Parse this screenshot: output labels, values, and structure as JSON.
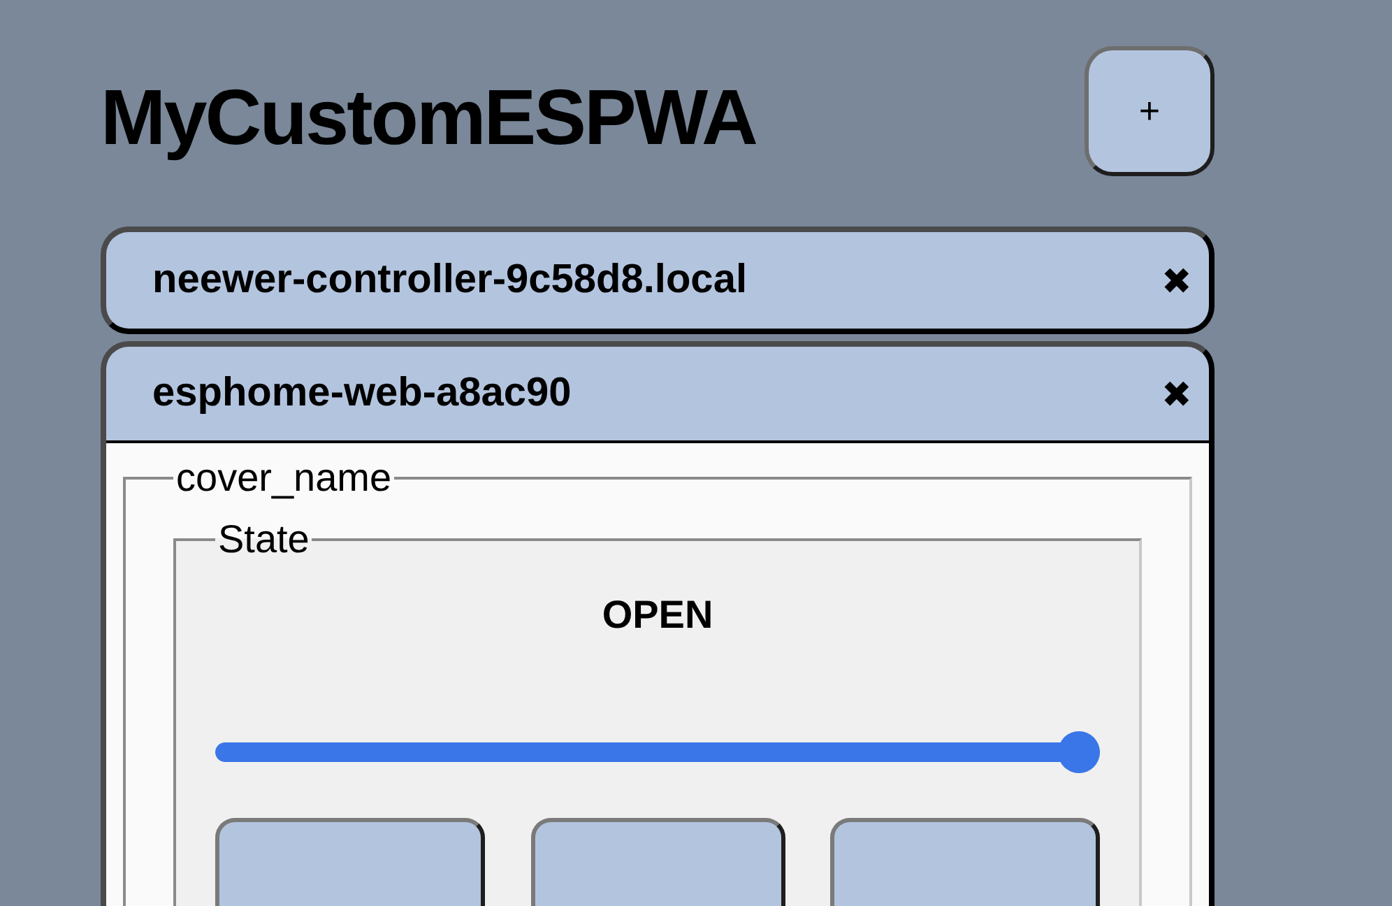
{
  "app_title": "MyCustomESPWA",
  "add_button": {
    "label": "+"
  },
  "devices": [
    {
      "name": "neewer-controller-9c58d8.local",
      "close_label": "✖",
      "expanded": false
    },
    {
      "name": "esphome-web-a8ac90",
      "close_label": "✖",
      "expanded": true,
      "entity": {
        "name": "cover_name",
        "state_legend": "State",
        "state": "OPEN",
        "position": {
          "level": 1
        }
      }
    }
  ]
}
